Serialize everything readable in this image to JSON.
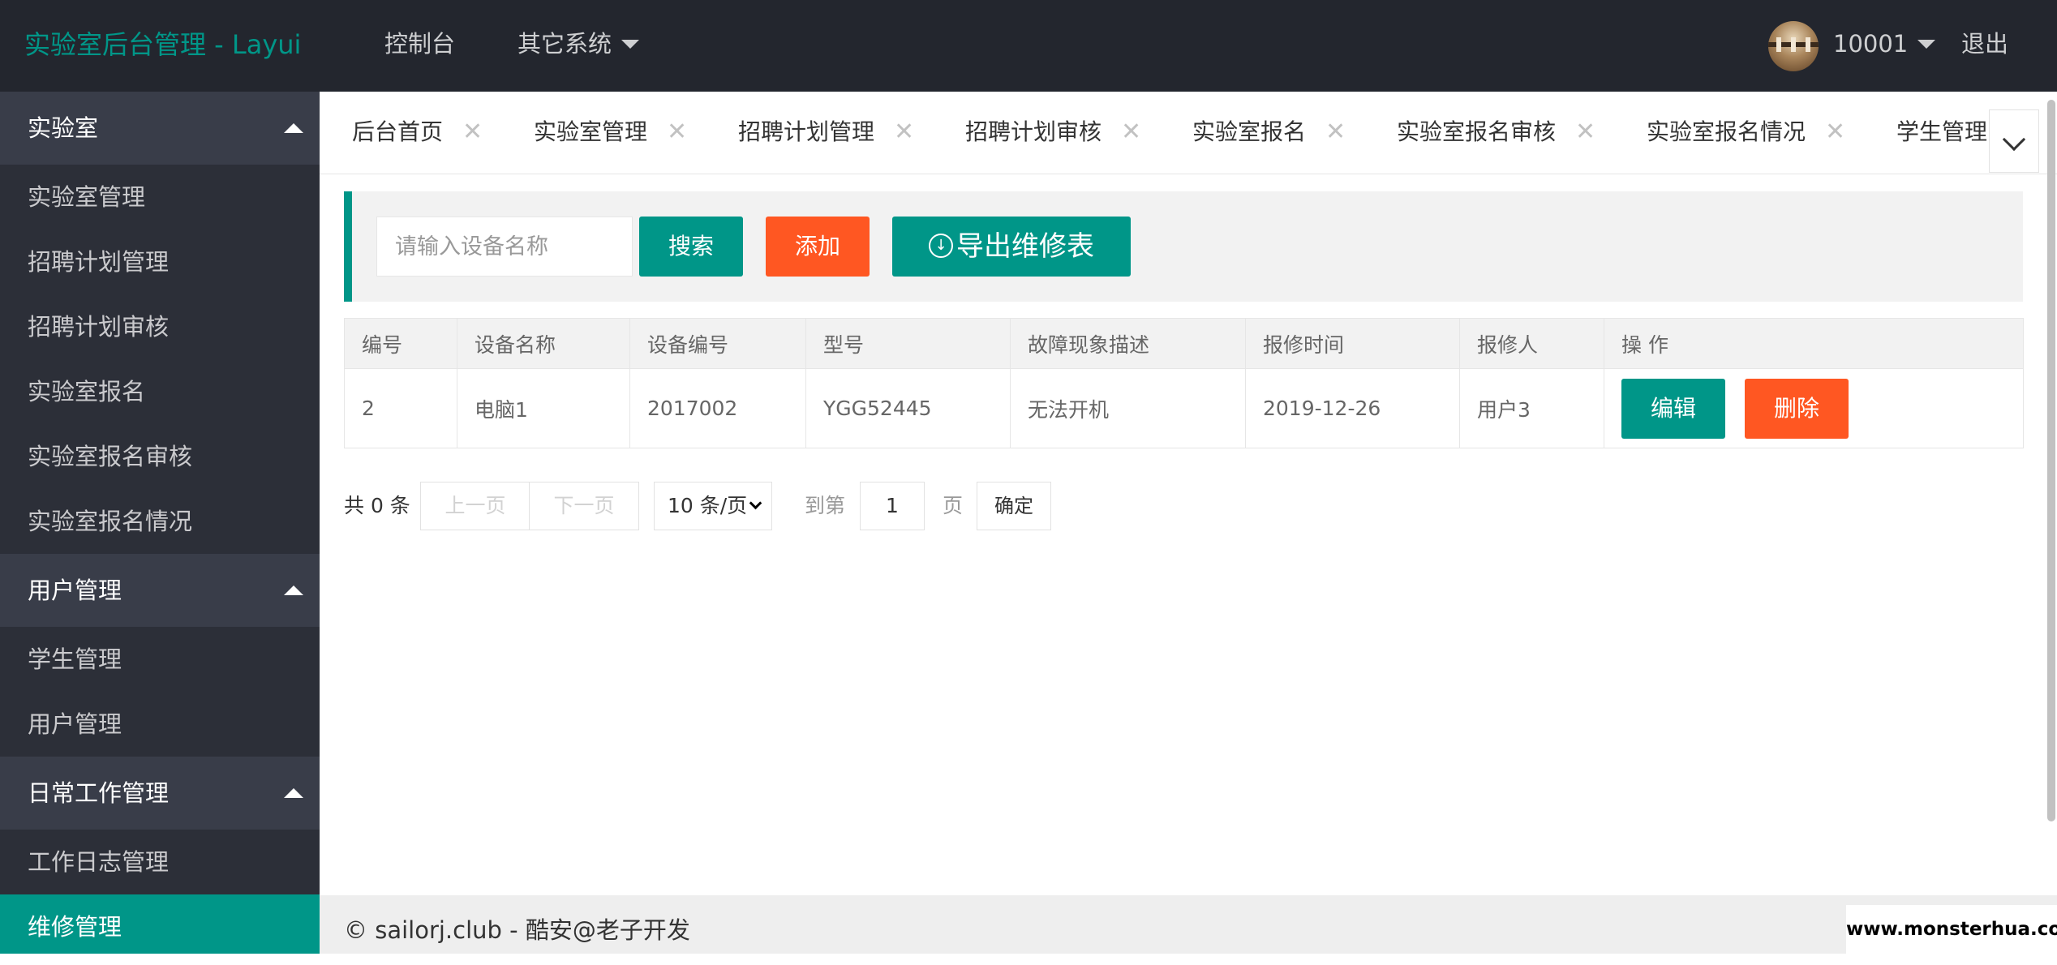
{
  "app": {
    "title": "实验室后台管理 - Layui"
  },
  "topnav": {
    "console": "控制台",
    "other_systems": "其它系统"
  },
  "user": {
    "name": "10001",
    "logout": "退出"
  },
  "sidebar": {
    "groups": [
      {
        "label": "实验室",
        "items": [
          "实验室管理",
          "招聘计划管理",
          "招聘计划审核",
          "实验室报名",
          "实验室报名审核",
          "实验室报名情况"
        ]
      },
      {
        "label": "用户管理",
        "items": [
          "学生管理",
          "用户管理"
        ]
      },
      {
        "label": "日常工作管理",
        "items": [
          "工作日志管理",
          "维修管理"
        ]
      }
    ],
    "active_item": "维修管理"
  },
  "tabs": [
    "后台首页",
    "实验室管理",
    "招聘计划管理",
    "招聘计划审核",
    "实验室报名",
    "实验室报名审核",
    "实验室报名情况",
    "学生管理"
  ],
  "tab_close": "✕",
  "search": {
    "placeholder": "请输入设备名称",
    "search_label": "搜索",
    "add_label": "添加",
    "export_label": "导出维修表"
  },
  "table": {
    "headers": [
      "编号",
      "设备名称",
      "设备编号",
      "型号",
      "故障现象描述",
      "报修时间",
      "报修人",
      "操 作"
    ],
    "rows": [
      {
        "id": "2",
        "name": "电脑1",
        "code": "2017002",
        "model": "YGG52445",
        "fault": "无法开机",
        "time": "2019-12-26",
        "reporter": "用户3"
      }
    ],
    "edit_label": "编辑",
    "delete_label": "删除"
  },
  "pager": {
    "total": "共 0 条",
    "prev": "上一页",
    "next": "下一页",
    "page_size": "10 条/页",
    "goto_prefix": "到第",
    "page_value": "1",
    "goto_suffix": "页",
    "confirm": "确定"
  },
  "footer": {
    "text": "© sailorj.club - 酷安@老子开发"
  },
  "watermark": "www.monsterhua.com",
  "colors": {
    "accent": "#009688",
    "danger": "#ff5722",
    "header_bg": "#23262e",
    "sidebar_bg": "#393d49"
  }
}
